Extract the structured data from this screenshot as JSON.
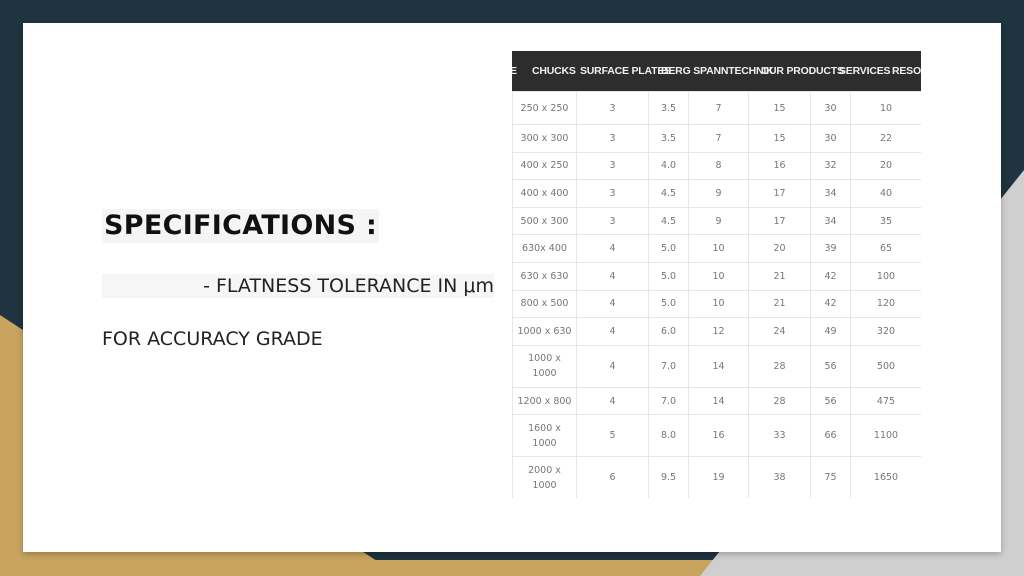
{
  "slide": {
    "title": "SPECIFICATIONS :",
    "line1": "- FLATNESS TOLERANCE IN μm",
    "line2": "FOR ACCURACY GRADE"
  },
  "nav": {
    "items": [
      "E",
      "CHUCKS",
      "SURFACE PLATES",
      "BERG SPANNTECHNIK",
      "OUR PRODUCTS",
      "SERVICES",
      "RESOU"
    ]
  },
  "table": {
    "rows": [
      [
        "250 x 250",
        "3",
        "3.5",
        "7",
        "15",
        "30",
        "10"
      ],
      [
        "300 x 300",
        "3",
        "3.5",
        "7",
        "15",
        "30",
        "22"
      ],
      [
        "400 x 250",
        "3",
        "4.0",
        "8",
        "16",
        "32",
        "20"
      ],
      [
        "400 x 400",
        "3",
        "4.5",
        "9",
        "17",
        "34",
        "40"
      ],
      [
        "500 x 300",
        "3",
        "4.5",
        "9",
        "17",
        "34",
        "35"
      ],
      [
        "630x 400",
        "4",
        "5.0",
        "10",
        "20",
        "39",
        "65"
      ],
      [
        "630 x 630",
        "4",
        "5.0",
        "10",
        "21",
        "42",
        "100"
      ],
      [
        "800 x 500",
        "4",
        "5.0",
        "10",
        "21",
        "42",
        "120"
      ],
      [
        "1000 x 630",
        "4",
        "6.0",
        "12",
        "24",
        "49",
        "320"
      ],
      [
        "1000 x 1000",
        "4",
        "7.0",
        "14",
        "28",
        "56",
        "500"
      ],
      [
        "1200 x 800",
        "4",
        "7.0",
        "14",
        "28",
        "56",
        "475"
      ],
      [
        "1600 x 1000",
        "5",
        "8.0",
        "16",
        "33",
        "66",
        "1100"
      ],
      [
        "2000 x 1000",
        "6",
        "9.5",
        "19",
        "38",
        "75",
        "1650"
      ]
    ]
  },
  "colors": {
    "navy": "#1f3440",
    "gold": "#c8a45e",
    "grey": "#cfcfcf"
  }
}
